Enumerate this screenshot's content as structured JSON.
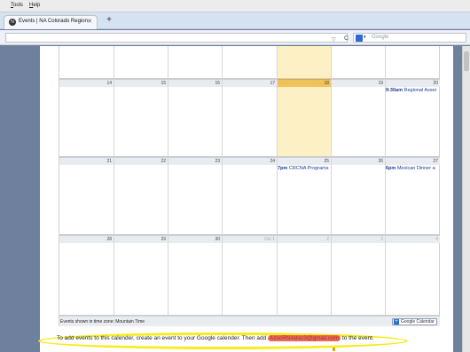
{
  "menu": [
    "Tools",
    "Help"
  ],
  "tab": {
    "title": "Events | NA Colorado Region",
    "close": "✕",
    "favicon": "N",
    "new_tab": "+"
  },
  "navbar": {
    "url_arrow": "▽",
    "reload": "C",
    "search_placeholder": "Google",
    "search_dropdown": "▾"
  },
  "calendar": {
    "weeks": [
      {
        "days": [
          {
            "num": "",
            "other": false,
            "today": false
          },
          {
            "num": "",
            "other": false,
            "today": false
          },
          {
            "num": "",
            "other": false,
            "today": false
          },
          {
            "num": "",
            "other": false,
            "today": false
          },
          {
            "num": "",
            "other": false,
            "today": true
          },
          {
            "num": "",
            "other": false,
            "today": false
          },
          {
            "num": "",
            "other": false,
            "today": false
          }
        ]
      },
      {
        "days": [
          {
            "num": "14",
            "other": false,
            "today": false
          },
          {
            "num": "15",
            "other": false,
            "today": false
          },
          {
            "num": "16",
            "other": false,
            "today": false
          },
          {
            "num": "17",
            "other": false,
            "today": false
          },
          {
            "num": "18",
            "other": false,
            "today": true
          },
          {
            "num": "19",
            "other": false,
            "today": false
          },
          {
            "num": "20",
            "other": false,
            "today": false,
            "event_time": "9:30am",
            "event_title": "Regional Asser"
          }
        ]
      },
      {
        "days": [
          {
            "num": "21",
            "other": false,
            "today": false
          },
          {
            "num": "22",
            "other": false,
            "today": false
          },
          {
            "num": "23",
            "other": false,
            "today": false
          },
          {
            "num": "24",
            "other": false,
            "today": false
          },
          {
            "num": "25",
            "other": false,
            "today": false,
            "event_time": "7pm",
            "event_title": "CRCNA Programs"
          },
          {
            "num": "26",
            "other": false,
            "today": false
          },
          {
            "num": "27",
            "other": false,
            "today": false,
            "event_time": "6pm",
            "event_title": "Mexican Dinner a"
          }
        ]
      },
      {
        "days": [
          {
            "num": "28",
            "other": false,
            "today": false
          },
          {
            "num": "29",
            "other": false,
            "today": false
          },
          {
            "num": "30",
            "other": false,
            "today": false
          },
          {
            "num": "Oct 1",
            "other": true,
            "today": false
          },
          {
            "num": "2",
            "other": true,
            "today": false
          },
          {
            "num": "3",
            "other": true,
            "today": false
          },
          {
            "num": "4",
            "other": true,
            "today": false
          }
        ]
      }
    ],
    "timezone_note": "Events shown in time zone: Mountain Time",
    "gcal_badge": "Google Calendar",
    "gcal_plus": "+"
  },
  "instruction": {
    "before": "To add events to this calender, create an event to your Google calender. Then add ",
    "email": "AzscRNAdoc3@gmail.com",
    "after": " to the event."
  },
  "colors": {
    "today": "#fdf0c4",
    "today_header": "#f0c35a",
    "event_text": "#1a3b8f",
    "highlight_ellipse": "#f7ec1e",
    "email_highlight": "#ec6b5a"
  }
}
